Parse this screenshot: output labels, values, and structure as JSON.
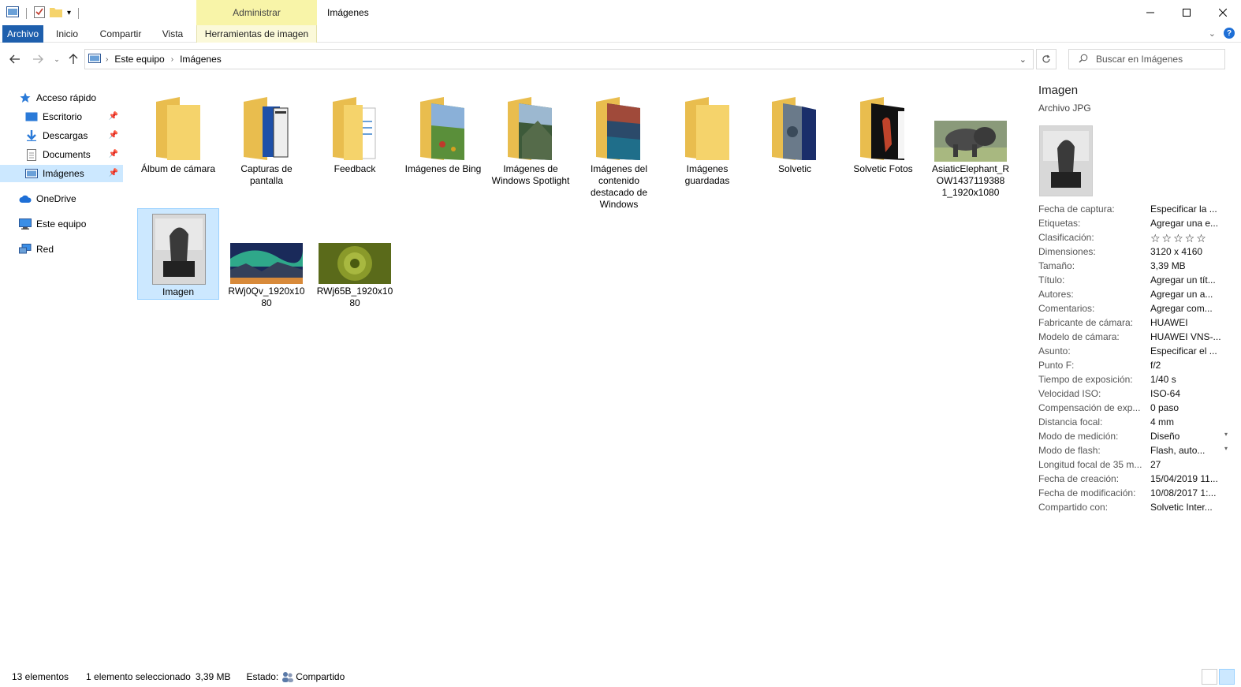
{
  "window": {
    "title": "Imágenes",
    "contextual_group": "Administrar"
  },
  "ribbon": {
    "tabs": [
      "Archivo",
      "Inicio",
      "Compartir",
      "Vista",
      "Herramientas de imagen"
    ]
  },
  "address": {
    "crumbs": [
      "Este equipo",
      "Imágenes"
    ],
    "search_placeholder": "Buscar en Imágenes"
  },
  "sidebar": {
    "items": [
      {
        "label": "Acceso rápido",
        "icon": "star-icon"
      },
      {
        "label": "Escritorio",
        "icon": "desktop-icon"
      },
      {
        "label": "Descargas",
        "icon": "download-icon"
      },
      {
        "label": "Documents",
        "icon": "document-icon"
      },
      {
        "label": "Imágenes",
        "icon": "pictures-icon"
      },
      {
        "label": "OneDrive",
        "icon": "cloud-icon"
      },
      {
        "label": "Este equipo",
        "icon": "computer-icon"
      },
      {
        "label": "Red",
        "icon": "network-icon"
      }
    ]
  },
  "files": [
    {
      "name": "Álbum de cámara",
      "kind": "folder"
    },
    {
      "name": "Capturas de pantalla",
      "kind": "folder"
    },
    {
      "name": "Feedback",
      "kind": "folder"
    },
    {
      "name": "Imágenes de Bing",
      "kind": "folder"
    },
    {
      "name": "Imágenes de Windows Spotlight",
      "kind": "folder"
    },
    {
      "name": "Imágenes del contenido destacado de Windows",
      "kind": "folder"
    },
    {
      "name": "Imágenes guardadas",
      "kind": "folder"
    },
    {
      "name": "Solvetic",
      "kind": "folder"
    },
    {
      "name": "Solvetic Fotos",
      "kind": "folder"
    },
    {
      "name": "AsiaticElephant_ROW1437119388 1_1920x1080",
      "kind": "image"
    },
    {
      "name": "Imagen",
      "kind": "image"
    },
    {
      "name": "RWj0Qv_1920x1080",
      "kind": "image"
    },
    {
      "name": "RWj65B_1920x1080",
      "kind": "image"
    }
  ],
  "details": {
    "title": "Imagen",
    "subtitle": "Archivo JPG",
    "properties": [
      {
        "k": "Fecha de captura:",
        "v": "Especificar la ..."
      },
      {
        "k": "Etiquetas:",
        "v": "Agregar una e..."
      },
      {
        "k": "Clasificación:",
        "v": "☆☆☆☆☆"
      },
      {
        "k": "Dimensiones:",
        "v": "3120 x 4160"
      },
      {
        "k": "Tamaño:",
        "v": "3,39 MB"
      },
      {
        "k": "Título:",
        "v": "Agregar un tít..."
      },
      {
        "k": "Autores:",
        "v": "Agregar un a..."
      },
      {
        "k": "Comentarios:",
        "v": "Agregar com..."
      },
      {
        "k": "Fabricante de cámara:",
        "v": "HUAWEI"
      },
      {
        "k": "Modelo de cámara:",
        "v": "HUAWEI VNS-..."
      },
      {
        "k": "Asunto:",
        "v": "Especificar el ..."
      },
      {
        "k": "Punto F:",
        "v": "f/2"
      },
      {
        "k": "Tiempo de exposición:",
        "v": "1/40 s"
      },
      {
        "k": "Velocidad ISO:",
        "v": "ISO-64"
      },
      {
        "k": "Compensación de exp...",
        "v": "0 paso"
      },
      {
        "k": "Distancia focal:",
        "v": "4 mm"
      },
      {
        "k": "Modo de medición:",
        "v": "Diseño"
      },
      {
        "k": "Modo de flash:",
        "v": "Flash, auto..."
      },
      {
        "k": "Longitud focal de 35 m...",
        "v": "27"
      },
      {
        "k": "Fecha de creación:",
        "v": "15/04/2019 11..."
      },
      {
        "k": "Fecha de modificación:",
        "v": "10/08/2017 1:..."
      },
      {
        "k": "Compartido con:",
        "v": "Solvetic Inter..."
      }
    ]
  },
  "status": {
    "count": "13 elementos",
    "selection": "1 elemento seleccionado",
    "size": "3,39 MB",
    "state_label": "Estado:",
    "state_value": "Compartido"
  },
  "colors": {
    "accent": "#1e5fad",
    "selection": "#cce8ff",
    "folder": "#f5d36b",
    "contextual": "#f8f4a8"
  }
}
